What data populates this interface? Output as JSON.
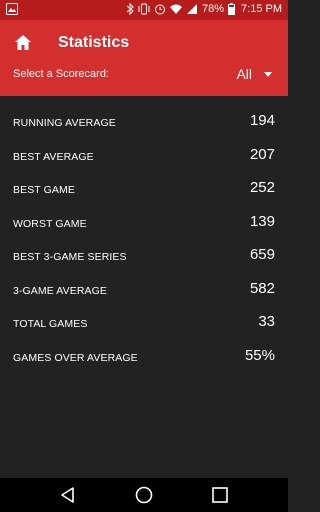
{
  "status_bar": {
    "battery_percent": "78%",
    "time": "7:15 PM"
  },
  "app_bar": {
    "title": "Statistics",
    "scorecard_label": "Select a Scorecard:",
    "scorecard_value": "All"
  },
  "stats": [
    {
      "label": "RUNNING AVERAGE",
      "value": "194"
    },
    {
      "label": "BEST AVERAGE",
      "value": "207"
    },
    {
      "label": "BEST GAME",
      "value": "252"
    },
    {
      "label": "WORST GAME",
      "value": "139"
    },
    {
      "label": "BEST 3-GAME SERIES",
      "value": "659"
    },
    {
      "label": "3-GAME AVERAGE",
      "value": "582"
    },
    {
      "label": "TOTAL GAMES",
      "value": "33"
    },
    {
      "label": "GAMES OVER AVERAGE",
      "value": "55%"
    }
  ],
  "colors": {
    "app_bar": "#d32f2f",
    "status_bar": "#b71c1c",
    "background": "#222222",
    "nav_bar": "#000000"
  }
}
